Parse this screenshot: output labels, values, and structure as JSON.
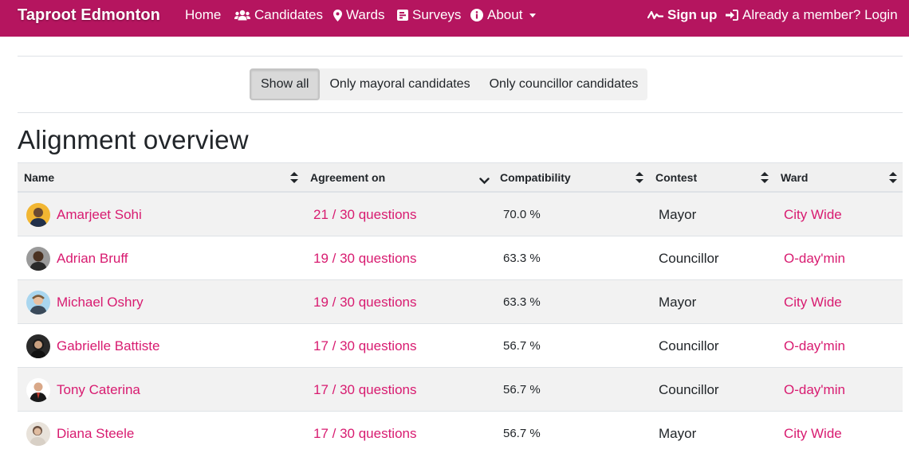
{
  "nav": {
    "brand": "Taproot Edmonton",
    "home": "Home",
    "candidates": "Candidates",
    "wards": "Wards",
    "surveys": "Surveys",
    "about": "About",
    "signup": "Sign up",
    "login": "Already a member? Login"
  },
  "filters": {
    "show_all": "Show all",
    "mayoral": "Only mayoral candidates",
    "councillor": "Only councillor candidates"
  },
  "title": "Alignment overview",
  "table": {
    "headers": {
      "name": "Name",
      "agreement": "Agreement on",
      "compatibility": "Compatibility",
      "contest": "Contest",
      "ward": "Ward"
    },
    "rows": [
      {
        "name": "Amarjeet Sohi",
        "agreement": "21 / 30 questions",
        "compatibility": "70.0 %",
        "contest": "Mayor",
        "ward": "City Wide"
      },
      {
        "name": "Adrian Bruff",
        "agreement": "19 / 30 questions",
        "compatibility": "63.3 %",
        "contest": "Councillor",
        "ward": "O-day'min"
      },
      {
        "name": "Michael Oshry",
        "agreement": "19 / 30 questions",
        "compatibility": "63.3 %",
        "contest": "Mayor",
        "ward": "City Wide"
      },
      {
        "name": "Gabrielle Battiste",
        "agreement": "17 / 30 questions",
        "compatibility": "56.7 %",
        "contest": "Councillor",
        "ward": "O-day'min"
      },
      {
        "name": "Tony Caterina",
        "agreement": "17 / 30 questions",
        "compatibility": "56.7 %",
        "contest": "Councillor",
        "ward": "O-day'min"
      },
      {
        "name": "Diana Steele",
        "agreement": "17 / 30 questions",
        "compatibility": "56.7 %",
        "contest": "Mayor",
        "ward": "City Wide"
      }
    ]
  },
  "colors": {
    "navbar": "#b5155f",
    "link": "#d81b70"
  },
  "icons": [
    "users-icon",
    "map-marker-icon",
    "poll-icon",
    "info-circle-icon",
    "caret-down-icon",
    "signature-icon",
    "sign-in-icon",
    "sort-icon",
    "sort-down-icon"
  ]
}
